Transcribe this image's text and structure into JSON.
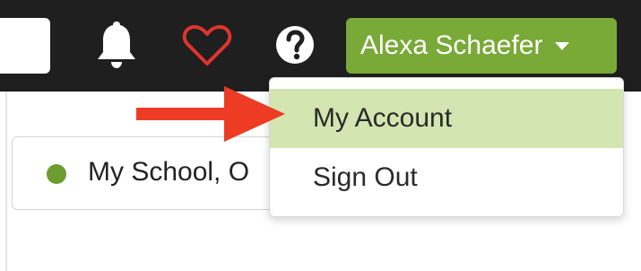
{
  "header": {
    "user_name": "Alexa Schaefer",
    "icons": [
      "bell-icon",
      "heart-icon",
      "help-icon",
      "caret-down-icon"
    ]
  },
  "school": {
    "label": "My School, O"
  },
  "user_menu": {
    "items": [
      {
        "label": "My Account",
        "highlighted": true
      },
      {
        "label": "Sign Out",
        "highlighted": false
      }
    ]
  },
  "annotation": {
    "arrow_color": "#ee3b24"
  },
  "colors": {
    "topbar": "#1f1f1f",
    "brand_green": "#79a937",
    "status_dot": "#6d9c2f",
    "menu_highlight": "#d3e5b0",
    "heart": "#e0342d"
  }
}
